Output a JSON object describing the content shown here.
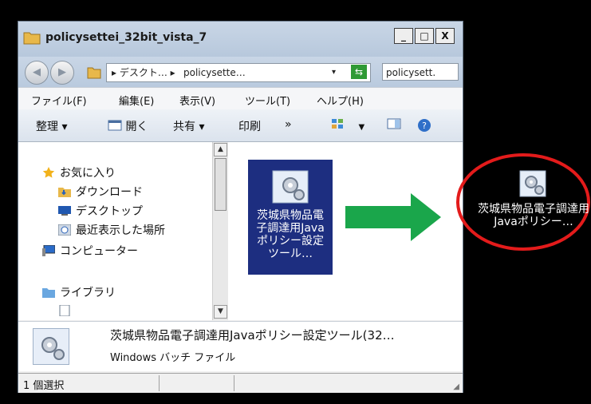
{
  "window": {
    "title": "policysettei_32bit_vista_7",
    "controls": {
      "minimize": "_",
      "maximize": "□",
      "close": "X"
    }
  },
  "address_bar": {
    "breadcrumb_1": "▸ デスクト… ▸",
    "breadcrumb_2": "policysette…",
    "dropdown": "▾",
    "search_value": "policysett."
  },
  "menubar": {
    "items": [
      "ファイル(F)",
      "編集(E)",
      "表示(V)",
      "ツール(T)",
      "ヘルプ(H)"
    ]
  },
  "toolbar": {
    "organize": "整理 ▾",
    "open": "開く",
    "share": "共有 ▾",
    "print": "印刷",
    "more": "»"
  },
  "nav_pane": {
    "favorites": "お気に入り",
    "items": [
      "ダウンロード",
      "デスクトップ",
      "最近表示した場所"
    ],
    "computer": "コンピューター",
    "libraries": "ライブラリ"
  },
  "file": {
    "label": "茨城県物品電子調達用Javaポリシー設定ツール…"
  },
  "details": {
    "name": "茨城県物品電子調達用Javaポリシー設定ツール(32…",
    "type": "Windows バッチ ファイル"
  },
  "status": {
    "selection": "1 個選択"
  },
  "desktop_icon": {
    "label": "茨城県物品電子調達用Javaポリシー…"
  },
  "colors": {
    "selection": "#1d2e80",
    "arrow": "#1aa64b",
    "highlight_ellipse": "#e31b1b"
  }
}
